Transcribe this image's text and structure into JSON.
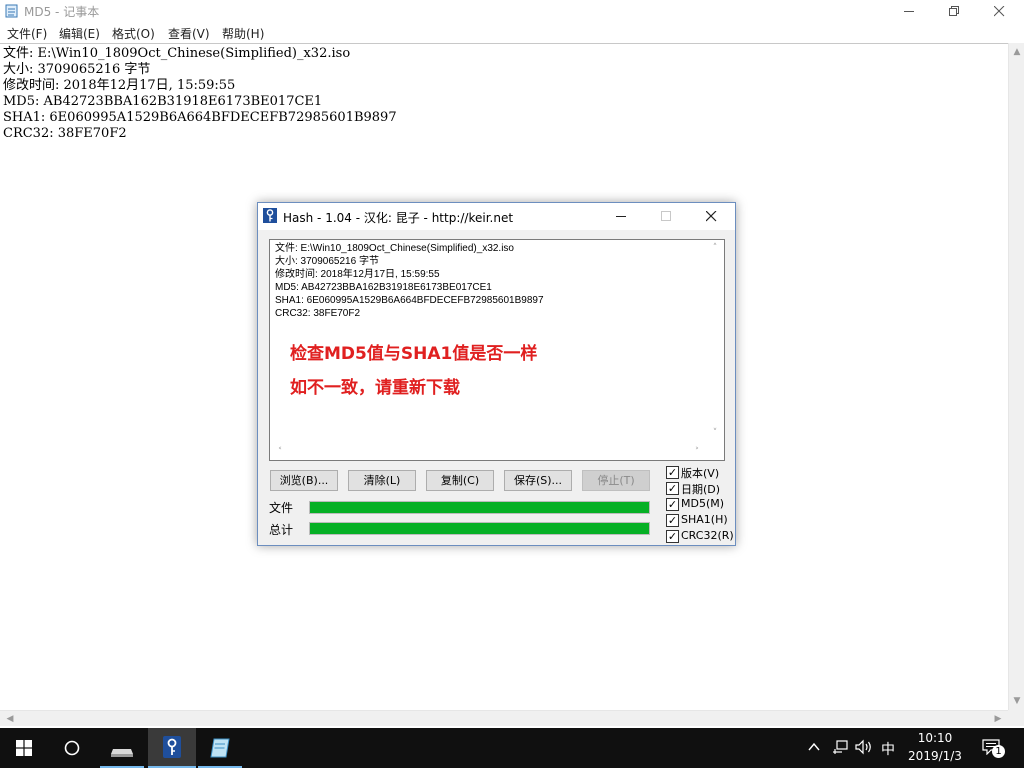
{
  "notepad": {
    "title": "MD5 - 记事本",
    "menu": [
      "文件(F)",
      "编辑(E)",
      "格式(O)",
      "查看(V)",
      "帮助(H)"
    ],
    "lines": [
      "文件: E:\\Win10_1809Oct_Chinese(Simplified)_x32.iso",
      "大小: 3709065216 字节",
      "修改时间: 2018年12月17日, 15:59:55",
      "MD5: AB42723BBA162B31918E6173BE017CE1",
      "SHA1: 6E060995A1529B6A664BFDECEFB72985601B9897",
      "CRC32: 38FE70F2"
    ]
  },
  "hash": {
    "title": "Hash - 1.04 - 汉化: 昆子 - http://keir.net",
    "lines": [
      "文件: E:\\Win10_1809Oct_Chinese(Simplified)_x32.iso",
      "大小: 3709065216 字节",
      "修改时间: 2018年12月17日, 15:59:55",
      "MD5: AB42723BBA162B31918E6173BE017CE1",
      "SHA1: 6E060995A1529B6A664BFDECEFB72985601B9897",
      "CRC32: 38FE70F2"
    ],
    "note_line1": "检查MD5值与SHA1值是否一样",
    "note_line2": "如不一致，请重新下载",
    "note_color": "#e02020",
    "buttons": {
      "browse": "浏览(B)...",
      "clear": "清除(L)",
      "copy": "复制(C)",
      "save": "保存(S)...",
      "stop": "停止(T)"
    },
    "checkboxes": [
      {
        "label": "版本(V)",
        "checked": true
      },
      {
        "label": "日期(D)",
        "checked": true
      },
      {
        "label": "MD5(M)",
        "checked": true
      },
      {
        "label": "SHA1(H)",
        "checked": true
      },
      {
        "label": "CRC32(R)",
        "checked": true
      }
    ],
    "progress": {
      "file_label": "文件",
      "file_value": 1.0,
      "total_label": "总计",
      "total_value": 1.0,
      "color": "#06b025"
    }
  },
  "taskbar": {
    "ime": "中",
    "time": "10:10",
    "date": "2019/1/3",
    "notification_count": "1"
  }
}
